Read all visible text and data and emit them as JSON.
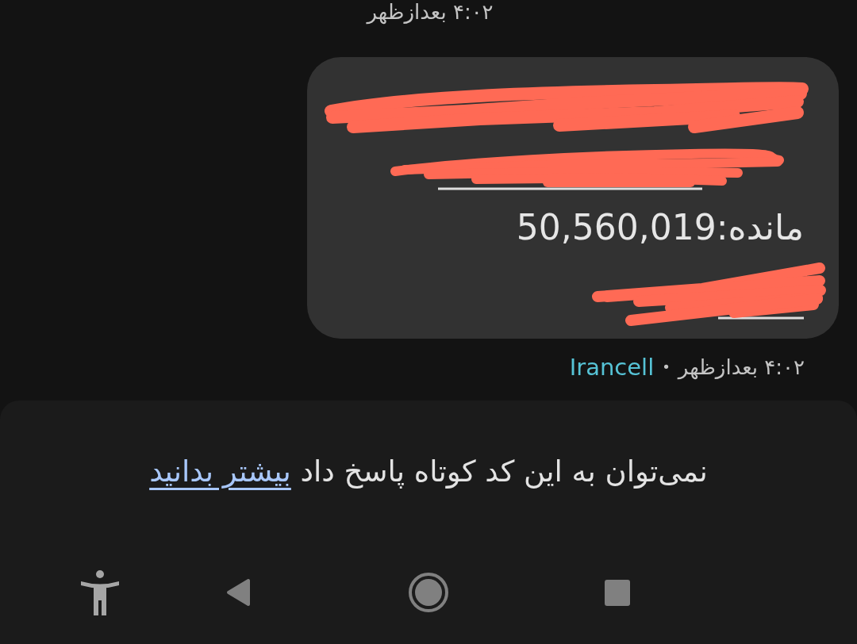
{
  "previous_message": {
    "time": "۴:۰۲ بعدازظهر"
  },
  "message": {
    "lines": [
      {
        "kind": "redacted",
        "underlined": false
      },
      {
        "kind": "redacted",
        "underlined": true
      },
      {
        "kind": "text",
        "text": "مانده:50,560,019"
      },
      {
        "kind": "redacted",
        "underlined": true
      }
    ],
    "time": "۴:۰۲ بعدازظهر",
    "separator": "•",
    "sender": "Irancell"
  },
  "reply_panel": {
    "notice": "نمی‌توان به این کد کوتاه پاسخ داد",
    "link": "بیشتر بدانید"
  }
}
